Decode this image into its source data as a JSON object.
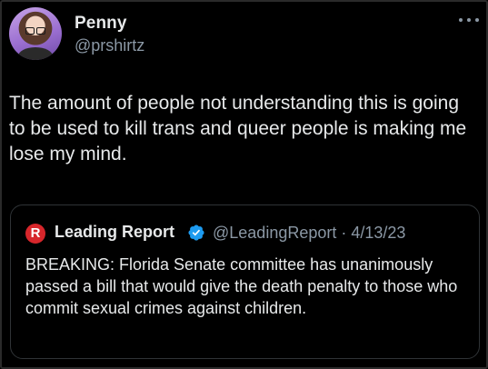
{
  "author": {
    "display_name": "Penny",
    "handle": "@prshirtz",
    "avatar_icon": "profile-photo"
  },
  "tweet": {
    "text": "The amount of people not understanding this is going to be used to kill trans and queer people is making me lose my mind."
  },
  "quoted": {
    "logo_letter": "R",
    "logo_color": "#d7262b",
    "display_name": "Leading Report",
    "verified_icon": "verified-badge-icon",
    "handle_date": "@LeadingReport · 4/13/23",
    "text": "BREAKING: Florida Senate committee has unanimously passed a bill that would give the death penalty to those who commit sexual crimes against children."
  },
  "colors": {
    "background": "#000000",
    "primary_text": "#e7e9ea",
    "secondary_text": "#8b98a5",
    "verified": "#1d9bf0",
    "border": "#2f3336"
  },
  "icons": {
    "more": "more-options-icon"
  }
}
